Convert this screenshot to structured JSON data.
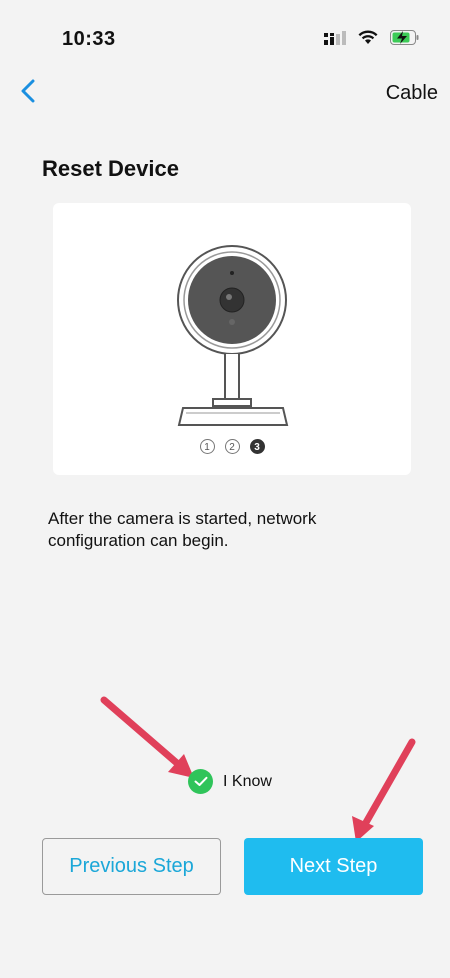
{
  "status_bar": {
    "time": "10:33"
  },
  "nav": {
    "back_icon": "chevron-left-icon",
    "right_action": "Cable"
  },
  "page": {
    "title": "Reset Device"
  },
  "illustration": {
    "steps": [
      "1",
      "2",
      "3"
    ],
    "active_step": 3
  },
  "description": "After the camera is started, network configuration can begin.",
  "acknowledge": {
    "label": "I Know",
    "checked": true
  },
  "buttons": {
    "previous": "Previous Step",
    "next": "Next Step"
  },
  "colors": {
    "accent": "#1fbcef",
    "accent_text": "#1ba7d8",
    "check_green": "#2fc45a",
    "arrow_red": "#e0405a"
  }
}
